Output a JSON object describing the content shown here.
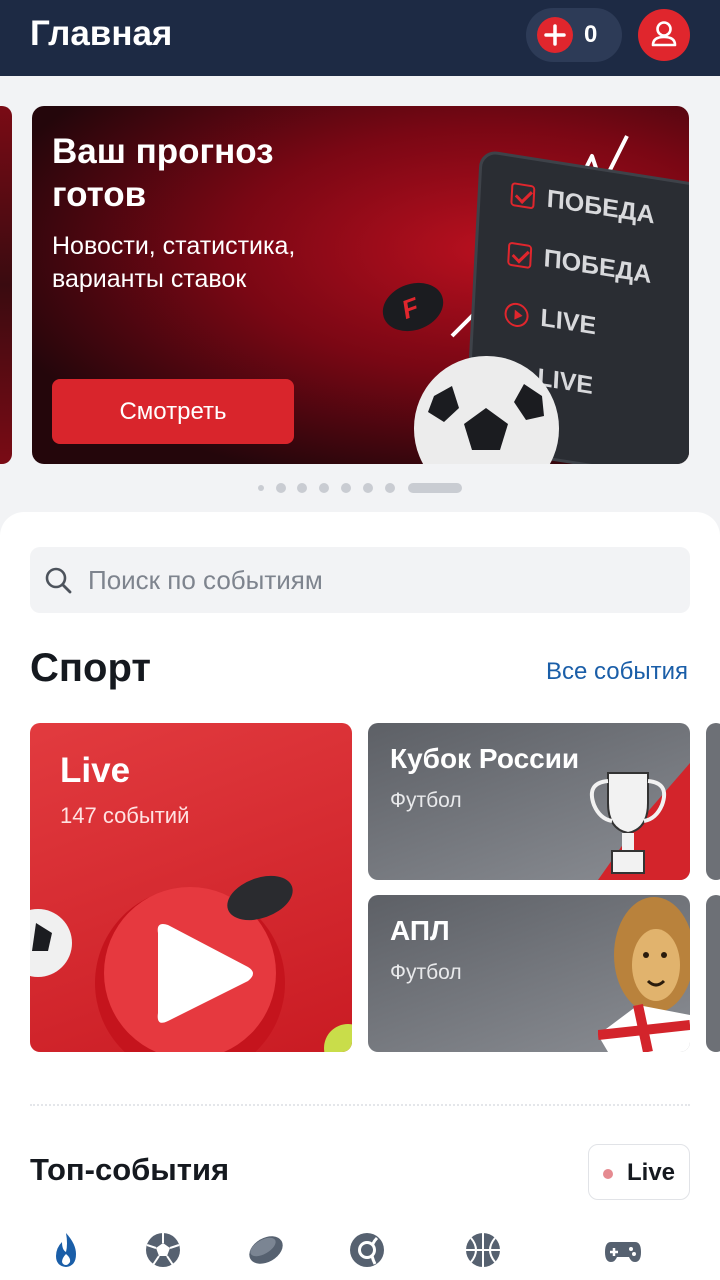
{
  "header": {
    "title": "Главная",
    "balance": "0",
    "add_icon": "plus-icon",
    "profile_icon": "user-icon"
  },
  "banner": {
    "title": "Ваш прогноз готов",
    "subtitle": "Новости, статистика, варианты ставок",
    "button_label": "Смотреть",
    "board_rows": [
      {
        "label": "ПОБЕДА",
        "icon": "checkbox-icon"
      },
      {
        "label": "ПОБЕДА",
        "icon": "checkbox-icon"
      },
      {
        "label": "LIVE",
        "icon": "play-icon"
      },
      {
        "label": "LIVE",
        "icon": "play-icon"
      }
    ],
    "puck_logo": "F",
    "pager": {
      "count": 8,
      "active_index": 7
    }
  },
  "search": {
    "placeholder": "Поиск по событиям",
    "value": ""
  },
  "sport": {
    "title": "Спорт",
    "all_link": "Все события",
    "live_card": {
      "title": "Live",
      "subtitle": "147 событий"
    },
    "cards": [
      {
        "title": "Кубок России",
        "subtitle": "Футбол",
        "icon": "trophy-icon"
      },
      {
        "title": "АПЛ",
        "subtitle": "Футбол",
        "icon": "lion-icon"
      }
    ]
  },
  "top_events": {
    "title": "Топ-события",
    "live_label": "Live",
    "sport_tabs": [
      {
        "name": "fire-icon",
        "active": true
      },
      {
        "name": "football-icon"
      },
      {
        "name": "hockey-puck-icon"
      },
      {
        "name": "tennis-icon"
      },
      {
        "name": "basketball-icon"
      },
      {
        "name": "gamepad-icon"
      }
    ]
  },
  "colors": {
    "header_bg": "#1d2a44",
    "accent_red": "#e0262d",
    "link_blue": "#1a5ea8",
    "active_tab_blue": "#1a5ea8"
  }
}
